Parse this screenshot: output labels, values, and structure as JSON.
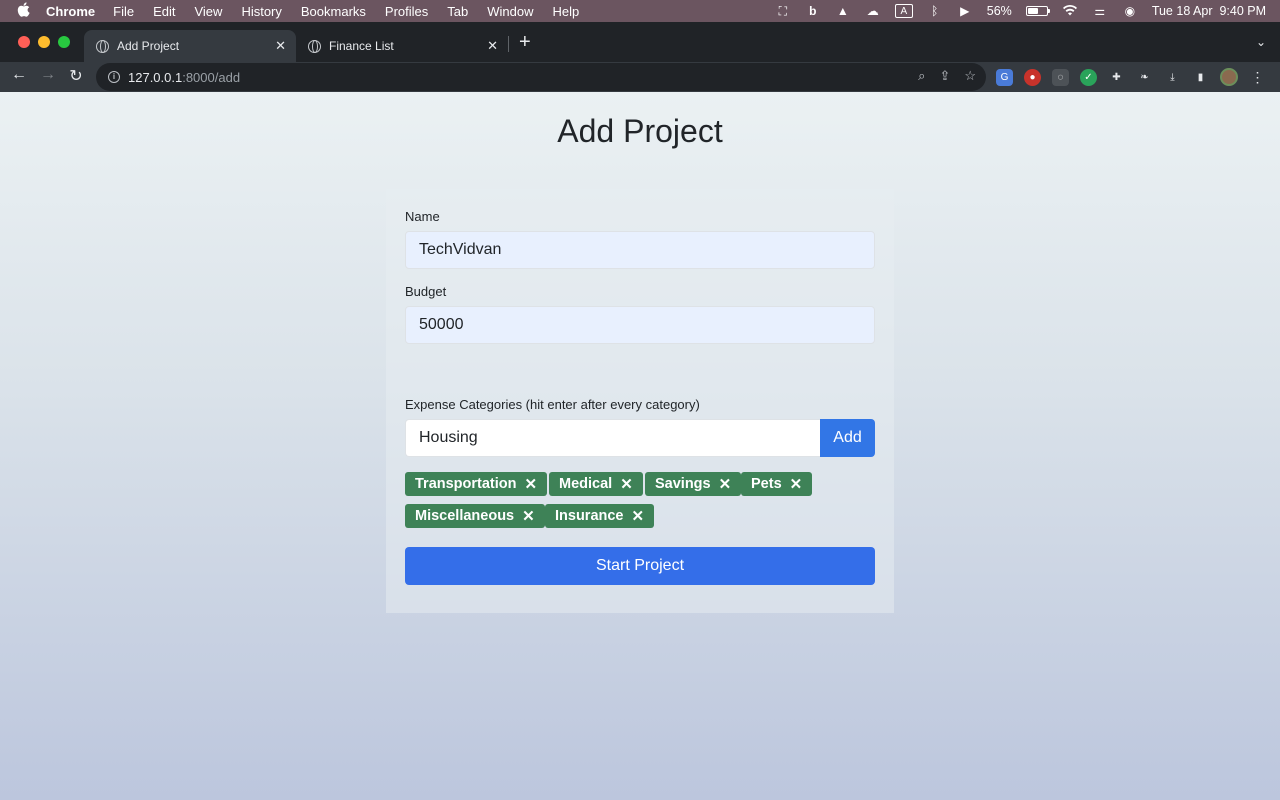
{
  "menubar": {
    "app_name": "Chrome",
    "menus": [
      "File",
      "Edit",
      "View",
      "History",
      "Bookmarks",
      "Profiles",
      "Tab",
      "Window",
      "Help"
    ],
    "battery_percent": "56%",
    "battery_level": 0.56,
    "datetime": "Tue 18 Apr  9:40 PM",
    "keyboard_indicator": "A"
  },
  "tabs": [
    {
      "title": "Add Project",
      "active": true
    },
    {
      "title": "Finance List",
      "active": false
    }
  ],
  "omnibox": {
    "host": "127.0.0.1",
    "path": ":8000/add"
  },
  "page": {
    "title": "Add Project",
    "name_label": "Name",
    "name_value": "TechVidvan",
    "budget_label": "Budget",
    "budget_value": "50000",
    "categories_label": "Expense Categories (hit enter after every category)",
    "category_input_value": "Housing",
    "add_button": "Add",
    "categories": [
      "Transportation",
      "Medical",
      "Savings",
      "Pets",
      "Miscellaneous",
      "Insurance"
    ],
    "chip_remove_glyph": "✕",
    "start_button": "Start Project"
  },
  "colors": {
    "primary": "#3276e6",
    "chip_green": "#3e8257"
  }
}
